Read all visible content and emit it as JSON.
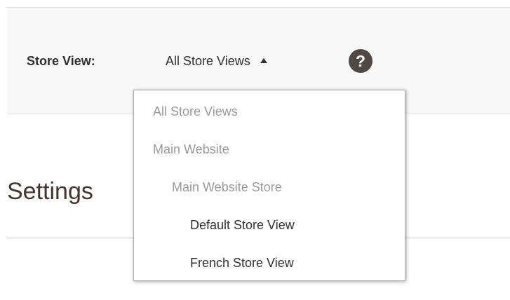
{
  "scope_switcher": {
    "label": "Store View:",
    "selected": "All Store Views",
    "help_icon": "question-circle-icon",
    "help_symbol": "?",
    "options": [
      {
        "label": "All Store Views",
        "level": 0,
        "enabled": false
      },
      {
        "label": "Main Website",
        "level": 1,
        "enabled": false
      },
      {
        "label": "Main Website Store",
        "level": 2,
        "enabled": false
      },
      {
        "label": "Default Store View",
        "level": 3,
        "enabled": true
      },
      {
        "label": "French Store View",
        "level": 3,
        "enabled": true
      }
    ]
  },
  "main": {
    "title": "Settings"
  },
  "colors": {
    "scope_bar_bg": "#f8f8f8",
    "help_icon_bg": "#514943",
    "disabled_text": "#999999",
    "text": "#303030"
  }
}
